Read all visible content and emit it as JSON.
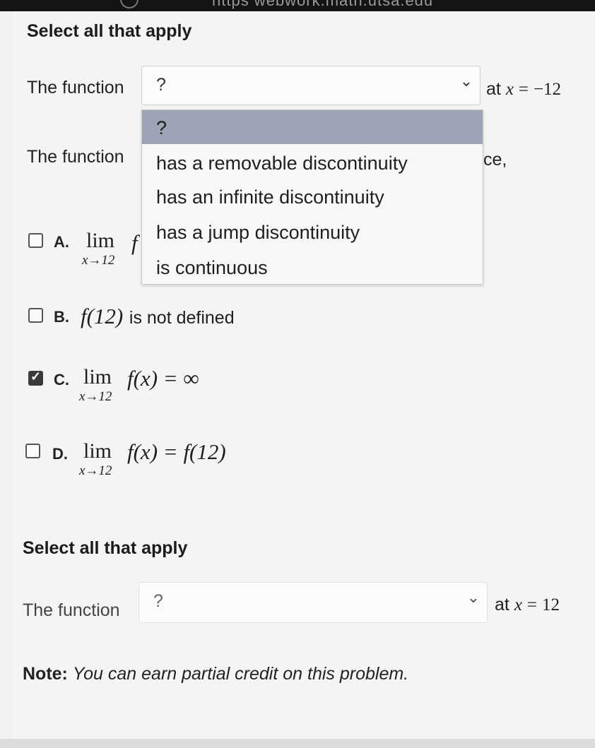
{
  "browser": {
    "url_partial": "https   webwork.math.utsa.edu"
  },
  "part1": {
    "heading": "Select all that apply",
    "function_label": "The function",
    "select_value": "?",
    "at_text": "at",
    "at_var": "x",
    "at_eq": "=",
    "at_value": "−12"
  },
  "dropdown": {
    "options": [
      "?",
      "has a removable discontinuity",
      "has an infinite discontinuity",
      "has a jump discontinuity",
      "is continuous"
    ],
    "selected_index": 0
  },
  "part2": {
    "function_label": "The function",
    "trailing_text": "ce,"
  },
  "choices": [
    {
      "letter": "A.",
      "lim": "lim",
      "sub": "x→12",
      "expr": "f",
      "checked": false
    },
    {
      "letter": "B.",
      "expr_math": "f(12)",
      "expr_text": "is not defined",
      "checked": false
    },
    {
      "letter": "C.",
      "lim": "lim",
      "sub": "x→12",
      "expr": "f(x) = ∞",
      "checked": true
    },
    {
      "letter": "D.",
      "lim": "lim",
      "sub": "x→12",
      "expr": "f(x) = f(12)",
      "checked": false
    }
  ],
  "part3": {
    "heading": "Select all that apply",
    "function_label": "The function",
    "select_value": "?",
    "at_text": "at",
    "at_var": "x",
    "at_eq": "=",
    "at_value": "12"
  },
  "note": {
    "label": "Note:",
    "text": "You can earn partial credit on this problem."
  },
  "icons": {
    "chevron": "chevron-down-icon",
    "check": "checkmark-icon"
  }
}
